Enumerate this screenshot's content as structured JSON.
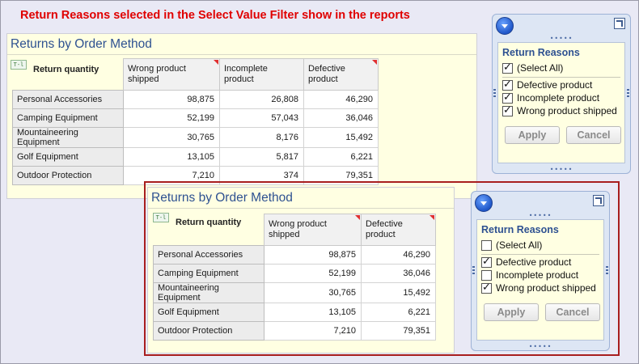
{
  "caption": "Return Reasons selected in the Select Value Filter show in the reports",
  "report1": {
    "title": "Returns by Order Method",
    "measure_label": "Return quantity",
    "icon": "T-l",
    "columns": [
      "Wrong product shipped",
      "Incomplete product",
      "Defective product"
    ],
    "rows": [
      {
        "label": "Personal Accessories",
        "values": [
          "98,875",
          "26,808",
          "46,290"
        ]
      },
      {
        "label": "Camping Equipment",
        "values": [
          "52,199",
          "57,043",
          "36,046"
        ]
      },
      {
        "label": "Mountaineering Equipment",
        "values": [
          "30,765",
          "8,176",
          "15,492"
        ]
      },
      {
        "label": "Golf Equipment",
        "values": [
          "13,105",
          "5,817",
          "6,221"
        ]
      },
      {
        "label": "Outdoor Protection",
        "values": [
          "7,210",
          "374",
          "79,351"
        ]
      }
    ]
  },
  "report2": {
    "title": "Returns by Order Method",
    "measure_label": "Return quantity",
    "icon": "T-l",
    "columns": [
      "Wrong product shipped",
      "Defective product"
    ],
    "rows": [
      {
        "label": "Personal Accessories",
        "values": [
          "98,875",
          "46,290"
        ]
      },
      {
        "label": "Camping Equipment",
        "values": [
          "52,199",
          "36,046"
        ]
      },
      {
        "label": "Mountaineering Equipment",
        "values": [
          "30,765",
          "15,492"
        ]
      },
      {
        "label": "Golf Equipment",
        "values": [
          "13,105",
          "6,221"
        ]
      },
      {
        "label": "Outdoor Protection",
        "values": [
          "7,210",
          "79,351"
        ]
      }
    ]
  },
  "filter1": {
    "title": "Return Reasons",
    "select_all": {
      "label": "(Select All)",
      "checked": true
    },
    "options": [
      {
        "label": "Defective product",
        "checked": true
      },
      {
        "label": "Incomplete product",
        "checked": true
      },
      {
        "label": "Wrong product shipped",
        "checked": true
      }
    ],
    "apply_label": "Apply",
    "cancel_label": "Cancel"
  },
  "filter2": {
    "title": "Return Reasons",
    "select_all": {
      "label": "(Select All)",
      "checked": false
    },
    "options": [
      {
        "label": "Defective product",
        "checked": true
      },
      {
        "label": "Incomplete product",
        "checked": false
      },
      {
        "label": "Wrong product shipped",
        "checked": true
      }
    ],
    "apply_label": "Apply",
    "cancel_label": "Cancel"
  },
  "colors": {
    "caption": "#e00000",
    "title_blue": "#2e5191",
    "panel_bg": "#ffffe2",
    "highlight_border": "#a81e1e"
  }
}
